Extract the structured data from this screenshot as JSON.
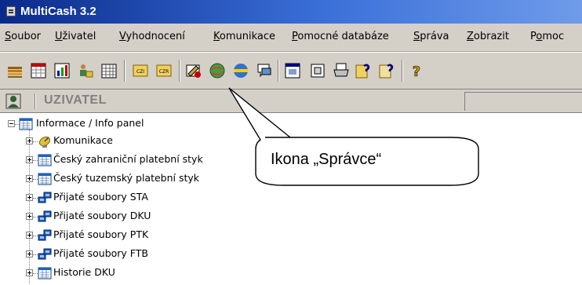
{
  "window": {
    "title": "MultiCash 3.2"
  },
  "menu": [
    {
      "label": "Soubor",
      "accel": "S",
      "rest": "oubor"
    },
    {
      "label": "Uživatel",
      "accel": "U",
      "rest": "živatel"
    },
    {
      "label": "Vyhodnocení",
      "accel": "V",
      "rest": "yhodnocení"
    },
    {
      "label": "Komunikace",
      "accel": "K",
      "rest": "omunikace"
    },
    {
      "label": "Pomocné databáze",
      "accel": "P",
      "rest": "omocné databáze"
    },
    {
      "label": "Správa",
      "accel": "S",
      "rest": "práva"
    },
    {
      "label": "Zobrazit",
      "accel": "Z",
      "rest": "obrazit"
    },
    {
      "label": "Pomoc",
      "pre": "P",
      "accel": "o",
      "rest": "moc"
    }
  ],
  "toolbar": {
    "czi_label": "CZI",
    "czr_label": "CZR",
    "help_glyph": "?"
  },
  "user_bar": {
    "label": "UZIVATEL"
  },
  "tree": {
    "root": "Informace / Info panel",
    "items": [
      {
        "label": "Komunikace",
        "icon": "satellite-dish-icon"
      },
      {
        "label": "Český zahraniční platební styk",
        "icon": "grid-panel-icon"
      },
      {
        "label": "Český tuzemský platební styk",
        "icon": "grid-panel-icon"
      },
      {
        "label": "Přijaté soubory STA",
        "icon": "network-computers-icon"
      },
      {
        "label": "Přijaté soubory DKU",
        "icon": "network-computers-icon"
      },
      {
        "label": "Přijaté soubory PTK",
        "icon": "network-computers-icon"
      },
      {
        "label": "Přijaté soubory FTB",
        "icon": "network-computers-icon"
      },
      {
        "label": "Historie DKU",
        "icon": "grid-panel-icon"
      }
    ]
  },
  "callout": {
    "text": "Ikona „Správce“"
  }
}
